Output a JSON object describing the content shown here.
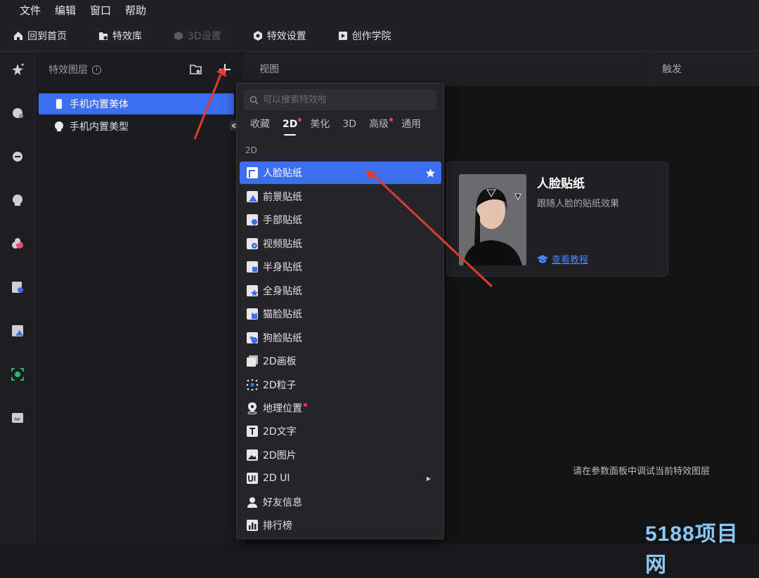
{
  "menubar": {
    "items": [
      "文件",
      "编辑",
      "窗口",
      "帮助"
    ]
  },
  "toolbar": {
    "home": "回到首页",
    "library": "特效库",
    "settings3d": "3D设置",
    "effect_settings": "特效设置",
    "academy": "创作学院"
  },
  "layers": {
    "title": "特效图层",
    "info_glyph": "i",
    "items": [
      "手机内置美体",
      "手机内置美型"
    ]
  },
  "view": {
    "title": "视图",
    "hint": "请在参数面板中调试当前特效图层"
  },
  "trigger": {
    "title": "触发"
  },
  "dropdown": {
    "search_placeholder": "可以搜索特效啦",
    "tabs": [
      "收藏",
      "2D",
      "美化",
      "3D",
      "高级",
      "通用"
    ],
    "section": "2D",
    "items": [
      "人脸贴纸",
      "前景贴纸",
      "手部贴纸",
      "视频贴纸",
      "半身贴纸",
      "全身贴纸",
      "猫脸贴纸",
      "狗脸贴纸",
      "2D画板",
      "2D粒子",
      "地理位置",
      "2D文字",
      "2D图片",
      "2D UI",
      "好友信息",
      "排行榜"
    ]
  },
  "preview": {
    "title": "人脸贴纸",
    "desc": "跟随人脸的贴纸效果",
    "link": "查看教程"
  },
  "watermark": "5188项目网",
  "colors": {
    "accent": "#3d6ef0",
    "link": "#4f82f7",
    "badge": "#ea3d5a",
    "annotation": "#e03a2f"
  }
}
